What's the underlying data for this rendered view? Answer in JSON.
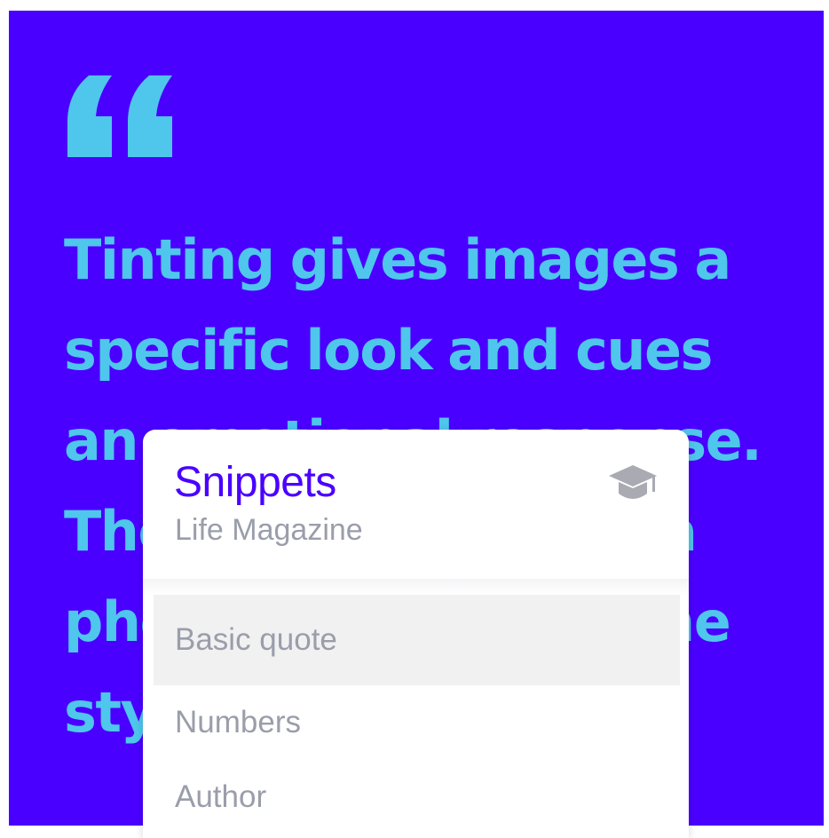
{
  "quote": {
    "text": "Tinting gives images a specific look and cues an emotional response. They can also make a photo match the same style"
  },
  "snippets_panel": {
    "title": "Snippets",
    "subtitle": "Life Magazine",
    "items": [
      {
        "label": "Basic quote",
        "active": true
      },
      {
        "label": "Numbers",
        "active": false
      },
      {
        "label": "Author",
        "active": false
      }
    ]
  },
  "colors": {
    "background": "#4a00ff",
    "quote_text": "#4fc6ec",
    "panel_title": "#4a00ff",
    "muted_text": "#9a9eaa",
    "active_item_bg": "#f1f1f2"
  },
  "icons": {
    "quote": "quote-icon",
    "cap": "graduation-cap-icon"
  }
}
